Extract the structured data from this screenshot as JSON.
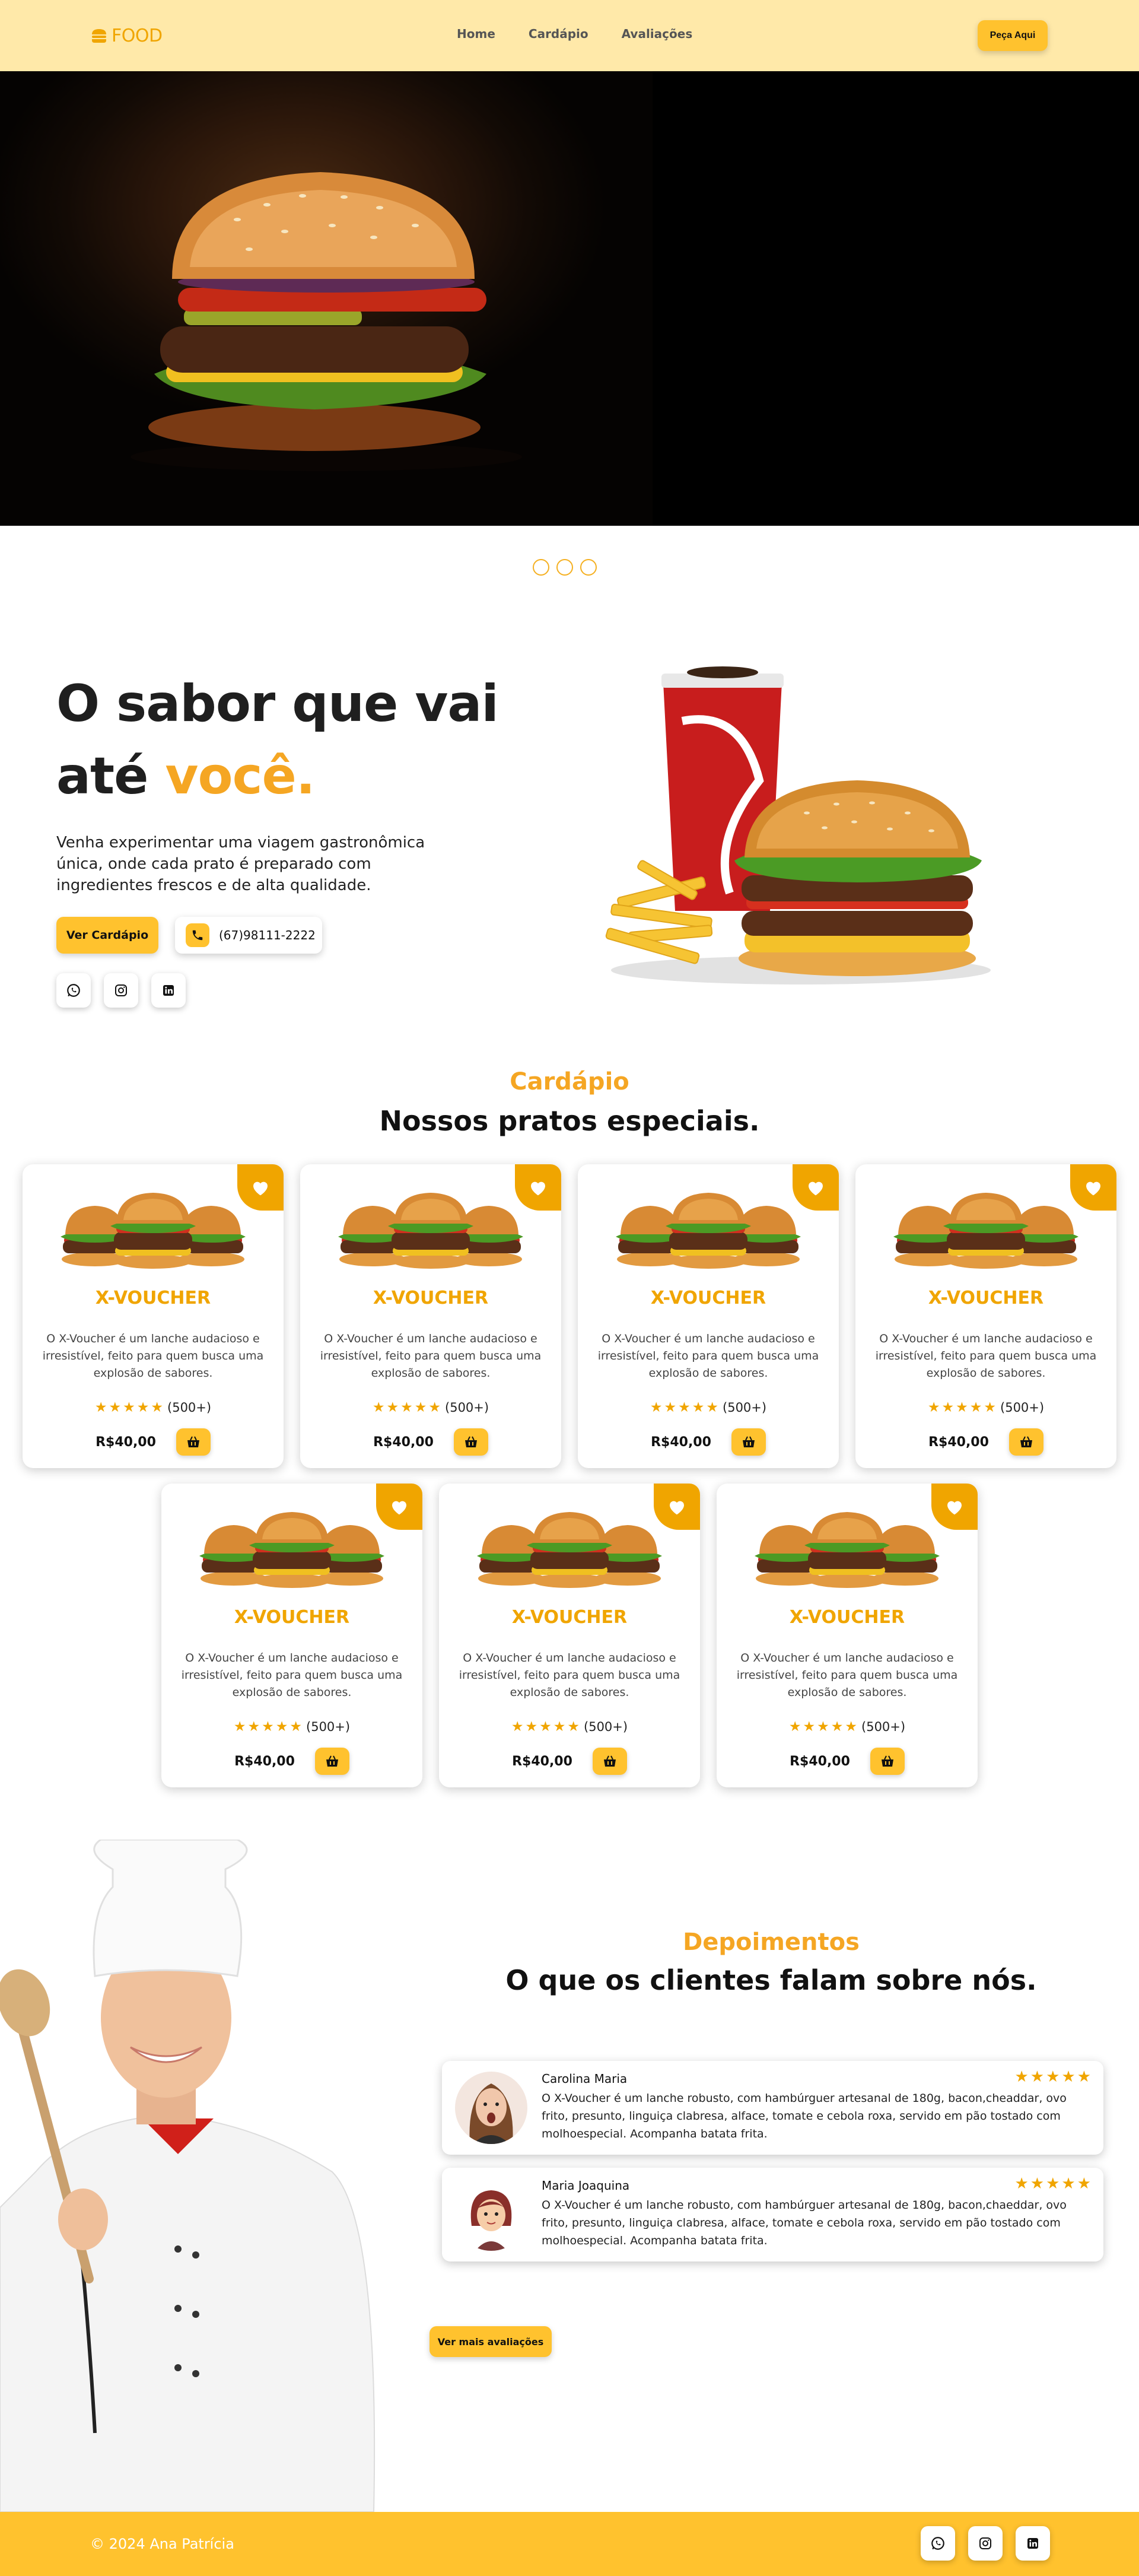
{
  "header": {
    "logo_text": "FOOD",
    "nav": [
      "Home",
      "Cardápio",
      "Avaliações"
    ],
    "cta": "Peça Aqui"
  },
  "intro": {
    "title_line1": "O sabor que vai",
    "title_line2_start": "até ",
    "title_line2_accent": "você.",
    "text": "Venha experimentar uma viagem gastronômica única, onde cada prato é preparado com ingredientes frescos e de alta qualidade.",
    "menu_button": "Ver Cardápio",
    "phone": "(67)98111-2222"
  },
  "menu": {
    "subtitle": "Cardápio",
    "title": "Nossos pratos especiais.",
    "items": [
      {
        "name": "X-VOUCHER",
        "desc": "O X-Voucher é um lanche audacioso e irresistível, feito para quem busca uma explosão de sabores.",
        "stars": "★★★★★",
        "rating_count": "(500+)",
        "price": "R$40,00"
      },
      {
        "name": "X-VOUCHER",
        "desc": "O X-Voucher é um lanche audacioso e irresistível, feito para quem busca uma explosão de sabores.",
        "stars": "★★★★★",
        "rating_count": "(500+)",
        "price": "R$40,00"
      },
      {
        "name": "X-VOUCHER",
        "desc": "O X-Voucher é um lanche audacioso e irresistível, feito para quem busca uma explosão de sabores.",
        "stars": "★★★★★",
        "rating_count": "(500+)",
        "price": "R$40,00"
      },
      {
        "name": "X-VOUCHER",
        "desc": "O X-Voucher é um lanche audacioso e irresistível, feito para quem busca uma explosão de sabores.",
        "stars": "★★★★★",
        "rating_count": "(500+)",
        "price": "R$40,00"
      },
      {
        "name": "X-VOUCHER",
        "desc": "O X-Voucher é um lanche audacioso e irresistível, feito para quem busca uma explosão de sabores.",
        "stars": "★★★★★",
        "rating_count": "(500+)",
        "price": "R$40,00"
      },
      {
        "name": "X-VOUCHER",
        "desc": "O X-Voucher é um lanche audacioso e irresistível, feito para quem busca uma explosão de sabores.",
        "stars": "★★★★★",
        "rating_count": "(500+)",
        "price": "R$40,00"
      },
      {
        "name": "X-VOUCHER",
        "desc": "O X-Voucher é um lanche audacioso e irresistível, feito para quem busca uma explosão de sabores.",
        "stars": "★★★★★",
        "rating_count": "(500+)",
        "price": "R$40,00"
      }
    ]
  },
  "testimonials": {
    "subtitle": "Depoimentos",
    "title": "O que os clientes falam sobre nós.",
    "reviews": [
      {
        "name": "Carolina Maria",
        "stars": "★★★★★",
        "text": "O X-Voucher é um lanche robusto, com hambúrguer artesanal de 180g, bacon,cheaddar, ovo frito, presunto, linguiça clabresa, alface, tomate e cebola roxa, servido em pão tostado com molhoespecial. Acompanha batata frita."
      },
      {
        "name": "Maria Joaquina",
        "stars": "★★★★★",
        "text": "O X-Voucher é um lanche robusto, com hambúrguer artesanal de 180g, bacon,chaeddar, ovo frito, presunto, linguiça clabresa, alface, tomate e cebola roxa, servido em pão tostado com molhoespecial. Acompanha batata frita."
      }
    ],
    "more_button": "Ver mais avaliações"
  },
  "footer": {
    "copyright": "© 2024 Ana Patrícia"
  },
  "colors": {
    "accent": "#f0a500",
    "button": "#ffc22e",
    "header_bg": "#ffe9a9"
  }
}
